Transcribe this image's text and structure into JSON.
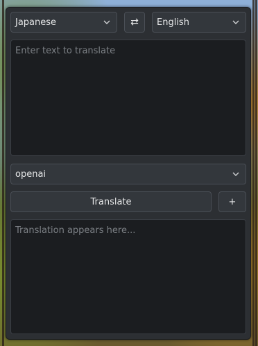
{
  "source_language": {
    "selected": "Japanese",
    "icon": "chevron-down-icon"
  },
  "swap_button": {
    "glyph": "⇄",
    "icon": "swap-icon"
  },
  "target_language": {
    "selected": "English",
    "icon": "chevron-down-icon"
  },
  "input_area": {
    "placeholder": "Enter text to translate",
    "value": ""
  },
  "provider": {
    "selected": "openai",
    "icon": "chevron-down-icon"
  },
  "translate_button": {
    "label": "Translate"
  },
  "add_button": {
    "label": "+"
  },
  "output_area": {
    "placeholder": "Translation appears here..."
  }
}
